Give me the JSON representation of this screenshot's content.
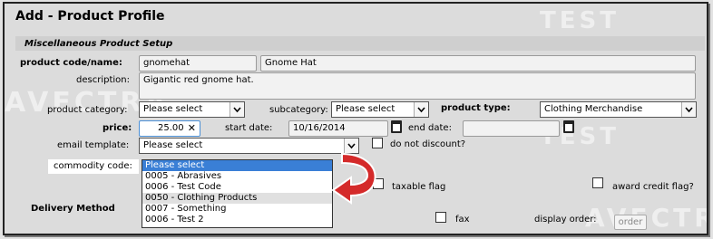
{
  "title": "Add - Product Profile",
  "section": "Miscellaneous Product Setup",
  "watermark_text": "AVECTRA TEST",
  "fields": {
    "product_code_label": "product code/name:",
    "product_code_value": "gnomehat",
    "product_name_value": "Gnome Hat",
    "description_label": "description:",
    "description_value": "Gigantic red gnome hat.",
    "category_label": "product category:",
    "category_value": "Please select",
    "subcategory_label": "subcategory:",
    "subcategory_value": "Please select",
    "type_label": "product type:",
    "type_value": "Clothing Merchandise",
    "price_label": "price:",
    "price_value": "25.00",
    "start_label": "start date:",
    "start_value": "10/16/2014",
    "end_label": "end date:",
    "end_value": "",
    "email_label": "email template:",
    "email_value": "Please select",
    "discount_label": "do not discount?",
    "commodity_label": "commodity code:",
    "taxable_label": "taxable flag",
    "award_label": "award credit flag?",
    "delivery_label": "Delivery Method",
    "fax_label": "fax",
    "display_order_label": "display order:",
    "order_placeholder": "order"
  },
  "dropdown_options": [
    "Please select",
    "0005 - Abrasives",
    "0006 - Test Code",
    "0050 - Clothing Products",
    "0007 - Something",
    "0006 - Test 2"
  ],
  "colors": {
    "highlight": "#3a7fd6",
    "arrow": "#d42a2a"
  }
}
